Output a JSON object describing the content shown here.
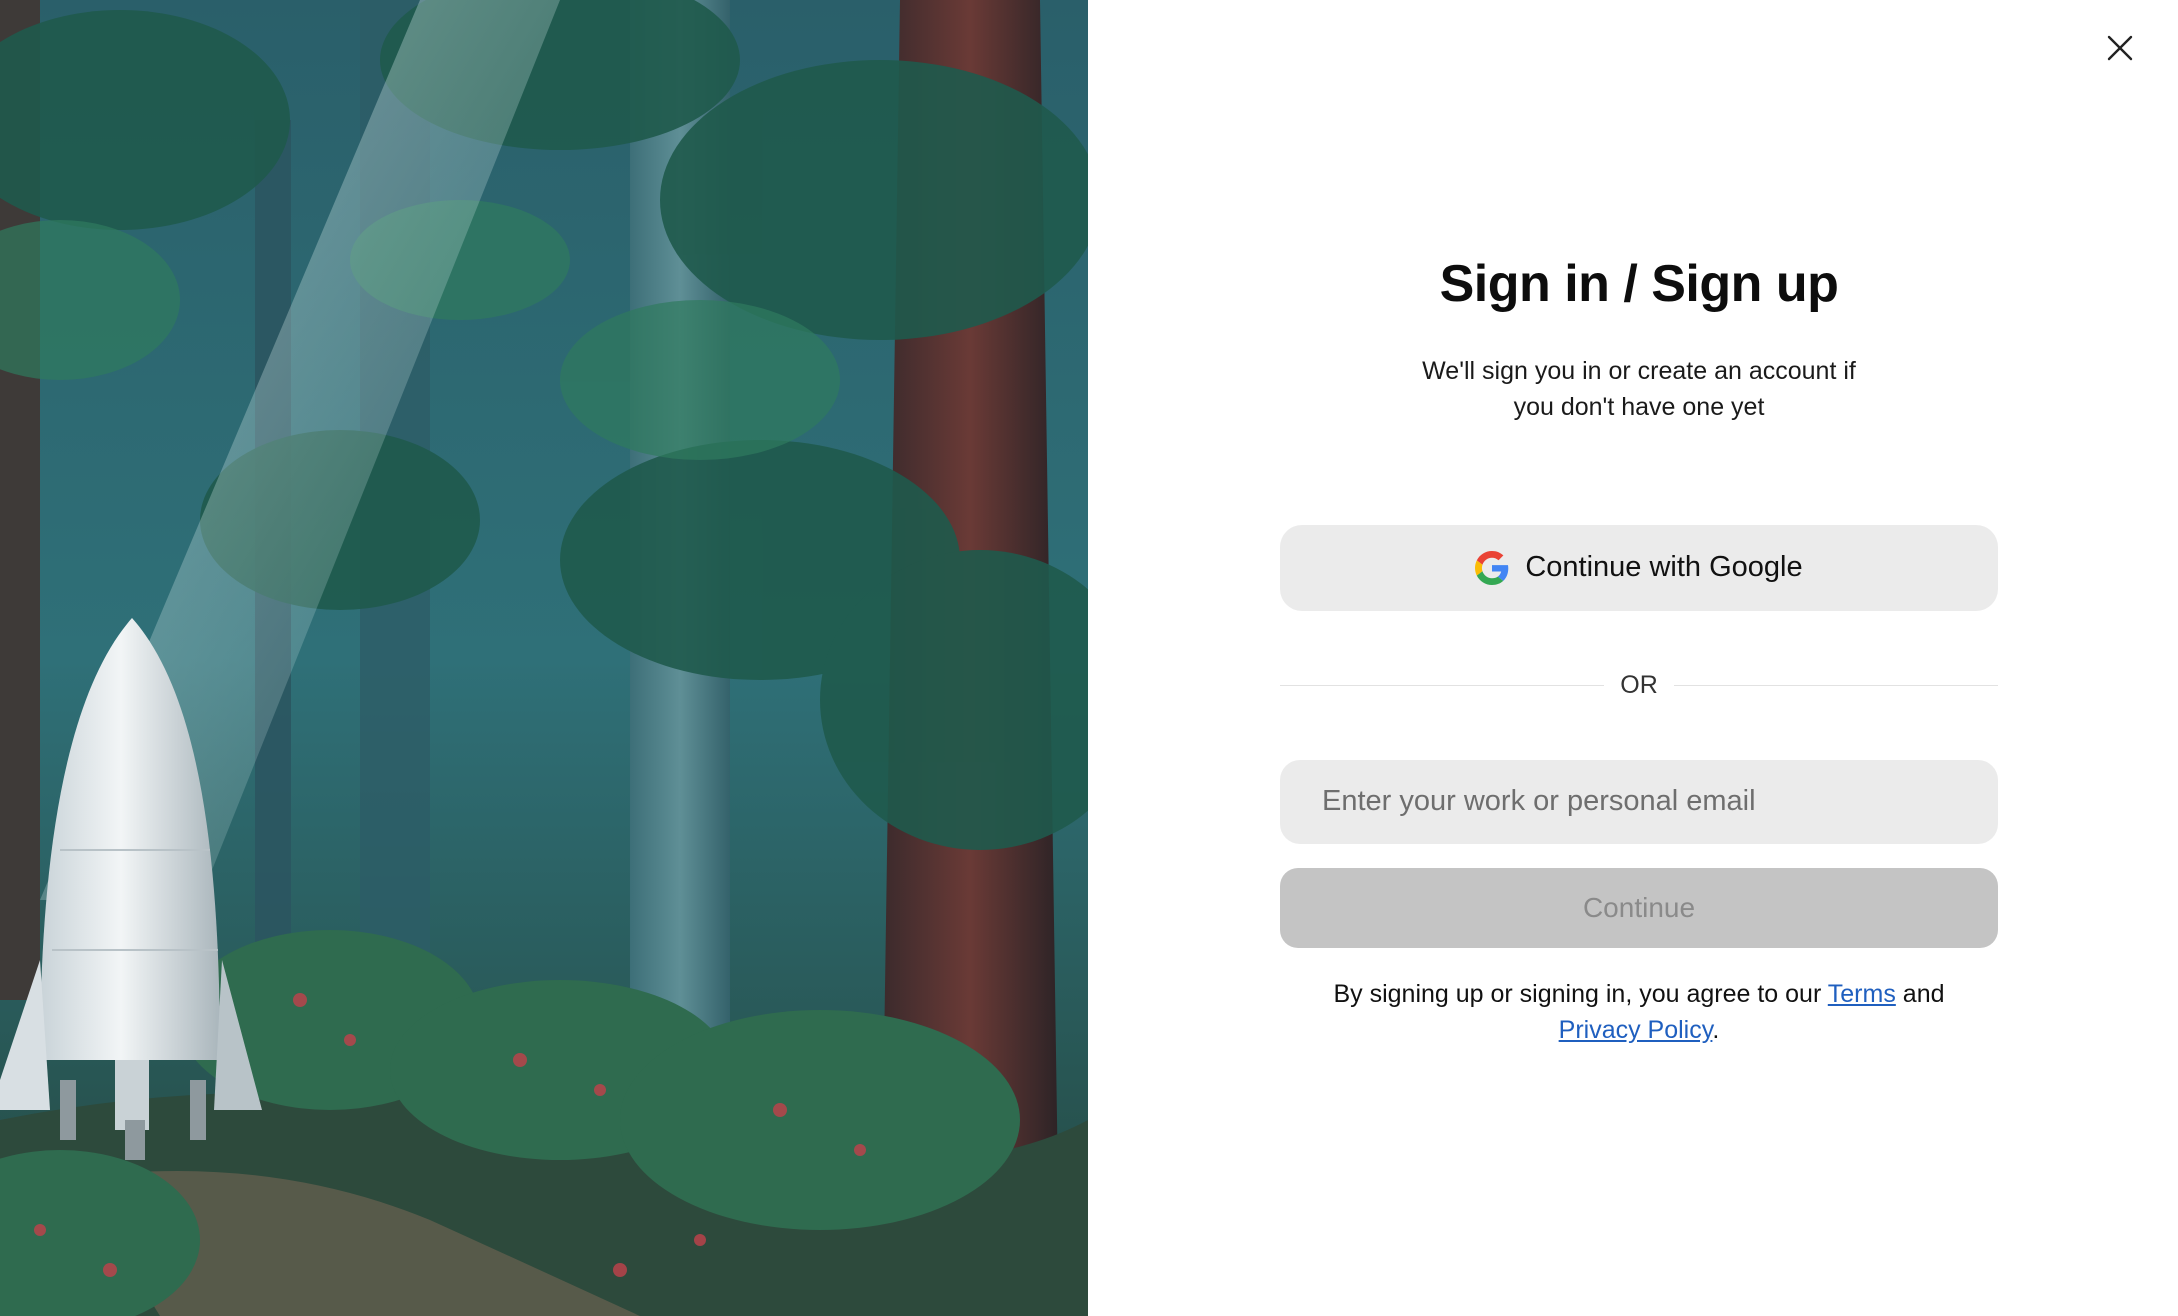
{
  "dialog": {
    "close_icon": "close-icon",
    "title": "Sign in / Sign up",
    "subtitle": "We'll sign you in or create an account if you don't have one yet",
    "google_button": {
      "label": "Continue with Google",
      "icon": "google-logo-icon"
    },
    "divider_text": "OR",
    "email_input": {
      "placeholder": "Enter your work or personal email",
      "value": ""
    },
    "continue_button": {
      "label": "Continue"
    },
    "legal": {
      "prefix": "By signing up or signing in, you agree to our ",
      "terms_link": "Terms",
      "middle": " and",
      "privacy_link": "Privacy Policy",
      "suffix": "."
    }
  },
  "colors": {
    "button_bg": "#ebebeb",
    "continue_disabled_bg": "#c4c4c4",
    "continue_disabled_text": "#8a8a8a",
    "link": "#1f5fbf"
  }
}
